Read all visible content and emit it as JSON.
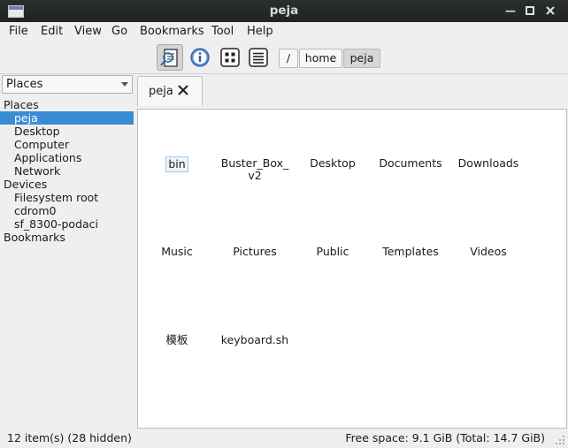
{
  "window": {
    "title": "peja"
  },
  "menu": {
    "file": "File",
    "edit": "Edit",
    "view": "View",
    "go": "Go",
    "bookmarks": "Bookmarks",
    "tool": "Tool",
    "help": "Help"
  },
  "toolbar": {
    "buttons": [
      "search-view-icon",
      "info-icon",
      "icon-view-icon",
      "detail-view-icon"
    ],
    "breadcrumb": [
      "/",
      "home",
      "peja"
    ]
  },
  "side": {
    "selector": "Places",
    "tree": [
      {
        "label": "Places",
        "level": 0
      },
      {
        "label": "peja",
        "level": 1,
        "selected": true
      },
      {
        "label": "Desktop",
        "level": 1
      },
      {
        "label": "Computer",
        "level": 1
      },
      {
        "label": "Applications",
        "level": 1
      },
      {
        "label": "Network",
        "level": 1
      },
      {
        "label": "Devices",
        "level": 0
      },
      {
        "label": "Filesystem root",
        "level": 1
      },
      {
        "label": "cdrom0",
        "level": 1
      },
      {
        "label": "sf_8300-podaci",
        "level": 1
      },
      {
        "label": "Bookmarks",
        "level": 0
      }
    ]
  },
  "tab": {
    "label": "peja"
  },
  "files": [
    {
      "l1": "bin",
      "l2": ""
    },
    {
      "l1": "Buster_Box_",
      "l2": "v2"
    },
    {
      "l1": "Desktop",
      "l2": ""
    },
    {
      "l1": "Documents",
      "l2": ""
    },
    {
      "l1": "Downloads",
      "l2": ""
    },
    {
      "l1": "Music",
      "l2": ""
    },
    {
      "l1": "Pictures",
      "l2": ""
    },
    {
      "l1": "Public",
      "l2": ""
    },
    {
      "l1": "Templates",
      "l2": ""
    },
    {
      "l1": "Videos",
      "l2": ""
    },
    {
      "l1": "模板",
      "l2": ""
    },
    {
      "l1": "keyboard.sh",
      "l2": ""
    }
  ],
  "status": {
    "items": "12 item(s) (28 hidden)",
    "free": "Free space: 9.1 GiB (Total: 14.7 GiB)"
  },
  "colors": {
    "selection": "#3a8dd4",
    "titlebar": "#1f2421",
    "view_bg": "#ffffff"
  }
}
